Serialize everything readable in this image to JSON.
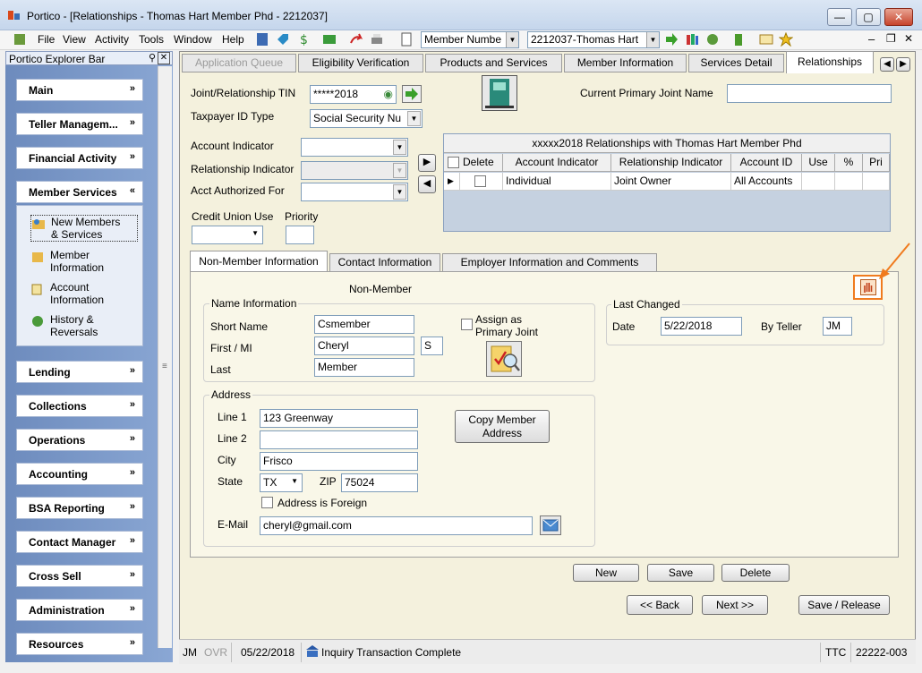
{
  "window": {
    "title": "Portico - [Relationships - Thomas Hart Member Phd - 2212037]"
  },
  "menu": {
    "items": [
      "File",
      "View",
      "Activity",
      "Tools",
      "Window",
      "Help"
    ]
  },
  "toolbar": {
    "search_type": "Member Numbe",
    "member": "2212037-Thomas Hart"
  },
  "explorer": {
    "title": "Portico Explorer Bar",
    "groups": [
      "Main",
      "Teller Managem...",
      "Financial Activity",
      "Member Services",
      "Lending",
      "Collections",
      "Operations",
      "Accounting",
      "BSA Reporting",
      "Contact Manager",
      "Cross Sell",
      "Administration",
      "Resources"
    ],
    "member_services_items": [
      {
        "line1": "New Members",
        "line2": "& Services"
      },
      {
        "line1": "Member",
        "line2": "Information"
      },
      {
        "line1": "Account",
        "line2": "Information"
      },
      {
        "line1": "History &",
        "line2": "Reversals"
      }
    ]
  },
  "tabs": [
    "Application Queue",
    "Eligibility Verification",
    "Products and Services",
    "Member Information",
    "Services Detail",
    "Relationships"
  ],
  "form": {
    "tin_label": "Joint/Relationship TIN",
    "tin_value": "*****2018",
    "taxid_type_label": "Taxpayer ID Type",
    "taxid_type_value": "Social Security Nu",
    "current_primary_label": "Current Primary Joint Name",
    "current_primary_value": "",
    "account_indicator_label": "Account Indicator",
    "relationship_indicator_label": "Relationship Indicator",
    "acct_authorized_label": "Acct Authorized For",
    "cu_use_label": "Credit Union Use",
    "priority_label": "Priority"
  },
  "grid": {
    "caption": "xxxxx2018 Relationships with Thomas Hart Member Phd",
    "columns": [
      "Delete",
      "Account Indicator",
      "Relationship Indicator",
      "Account ID",
      "Use",
      "%",
      "Pri"
    ],
    "rows": [
      {
        "account_indicator": "Individual",
        "relationship_indicator": "Joint Owner",
        "account_id": "All Accounts"
      }
    ]
  },
  "subtabs": [
    "Non-Member Information",
    "Contact Information",
    "Employer Information and Comments"
  ],
  "nonmember": {
    "heading": "Non-Member",
    "name_group": "Name Information",
    "short_name_label": "Short Name",
    "short_name": "Csmember",
    "first_mi_label": "First / MI",
    "first": "Cheryl",
    "mi": "S",
    "last_label": "Last",
    "last": "Member",
    "assign_primary_label": "Assign as Primary Joint",
    "address_group": "Address",
    "line1_label": "Line 1",
    "line1": "123 Greenway",
    "line2_label": "Line 2",
    "line2": "",
    "city_label": "City",
    "city": "Frisco",
    "state_label": "State",
    "state": "TX",
    "zip_label": "ZIP",
    "zip": "75024",
    "foreign_label": "Address is Foreign",
    "email_label": "E-Mail",
    "email": "cheryl@gmail.com",
    "copy_address_label": "Copy Member Address",
    "last_changed_group": "Last Changed",
    "date_label": "Date",
    "date": "5/22/2018",
    "teller_label": "By Teller",
    "teller": "JM"
  },
  "buttons": {
    "new": "New",
    "save": "Save",
    "delete": "Delete",
    "back": "<< Back",
    "next": "Next >>",
    "save_release": "Save / Release"
  },
  "status": {
    "user": "JM",
    "ovr": "OVR",
    "date": "05/22/2018",
    "message": "Inquiry Transaction Complete",
    "ttc": "TTC",
    "code": "22222-003"
  },
  "colors": {
    "accent_orange": "#f07b1e",
    "explorer_blue": "#7f9cca",
    "content_bg": "#f4f1dd"
  }
}
